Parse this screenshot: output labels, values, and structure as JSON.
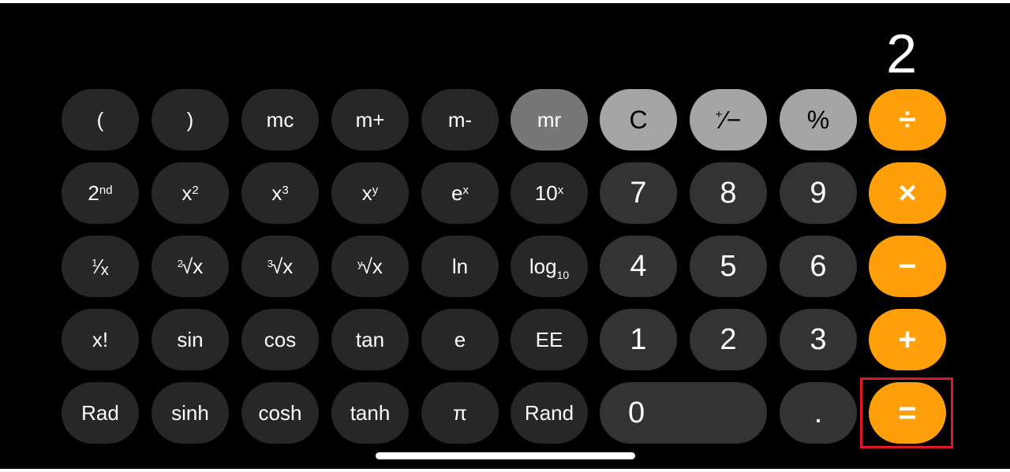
{
  "display": {
    "value": "2"
  },
  "keys": {
    "paren_open": "(",
    "paren_close": ")",
    "mc": "mc",
    "m_plus": "m+",
    "m_minus": "m-",
    "mr": "mr",
    "clear": "C",
    "plus_minus_top": "+",
    "plus_minus_bottom": "∕−",
    "percent": "%",
    "divide": "÷",
    "second_base": "2",
    "second_sup": "nd",
    "x_squared_base": "x",
    "x_squared_sup": "2",
    "x_cubed_base": "x",
    "x_cubed_sup": "3",
    "x_pow_y_base": "x",
    "x_pow_y_sup": "y",
    "e_pow_x_base": "e",
    "e_pow_x_sup": "x",
    "ten_pow_x_base": "10",
    "ten_pow_x_sup": "x",
    "seven": "7",
    "eight": "8",
    "nine": "9",
    "multiply": "×",
    "reciprocal_num": "1",
    "reciprocal_den": "x",
    "sqrt_index": "2",
    "sqrt_body": "√x",
    "cbrt_index": "3",
    "cbrt_body": "√x",
    "yroot_index": "y",
    "yroot_body": "√x",
    "ln": "ln",
    "log_base": "log",
    "log_sub": "10",
    "four": "4",
    "five": "5",
    "six": "6",
    "minus": "−",
    "factorial": "x!",
    "sin": "sin",
    "cos": "cos",
    "tan": "tan",
    "e": "e",
    "ee": "EE",
    "one": "1",
    "two": "2",
    "three": "3",
    "plus": "+",
    "rad": "Rad",
    "sinh": "sinh",
    "cosh": "cosh",
    "tanh": "tanh",
    "pi": "π",
    "rand": "Rand",
    "zero": "0",
    "decimal": ".",
    "equals": "="
  },
  "colors": {
    "background": "#000000",
    "operator": "#ff9f0a",
    "function_light": "#a5a5a5",
    "number": "#333333",
    "scientific": "#272727",
    "memory_active": "#777777",
    "highlight_box": "#e0192a"
  }
}
